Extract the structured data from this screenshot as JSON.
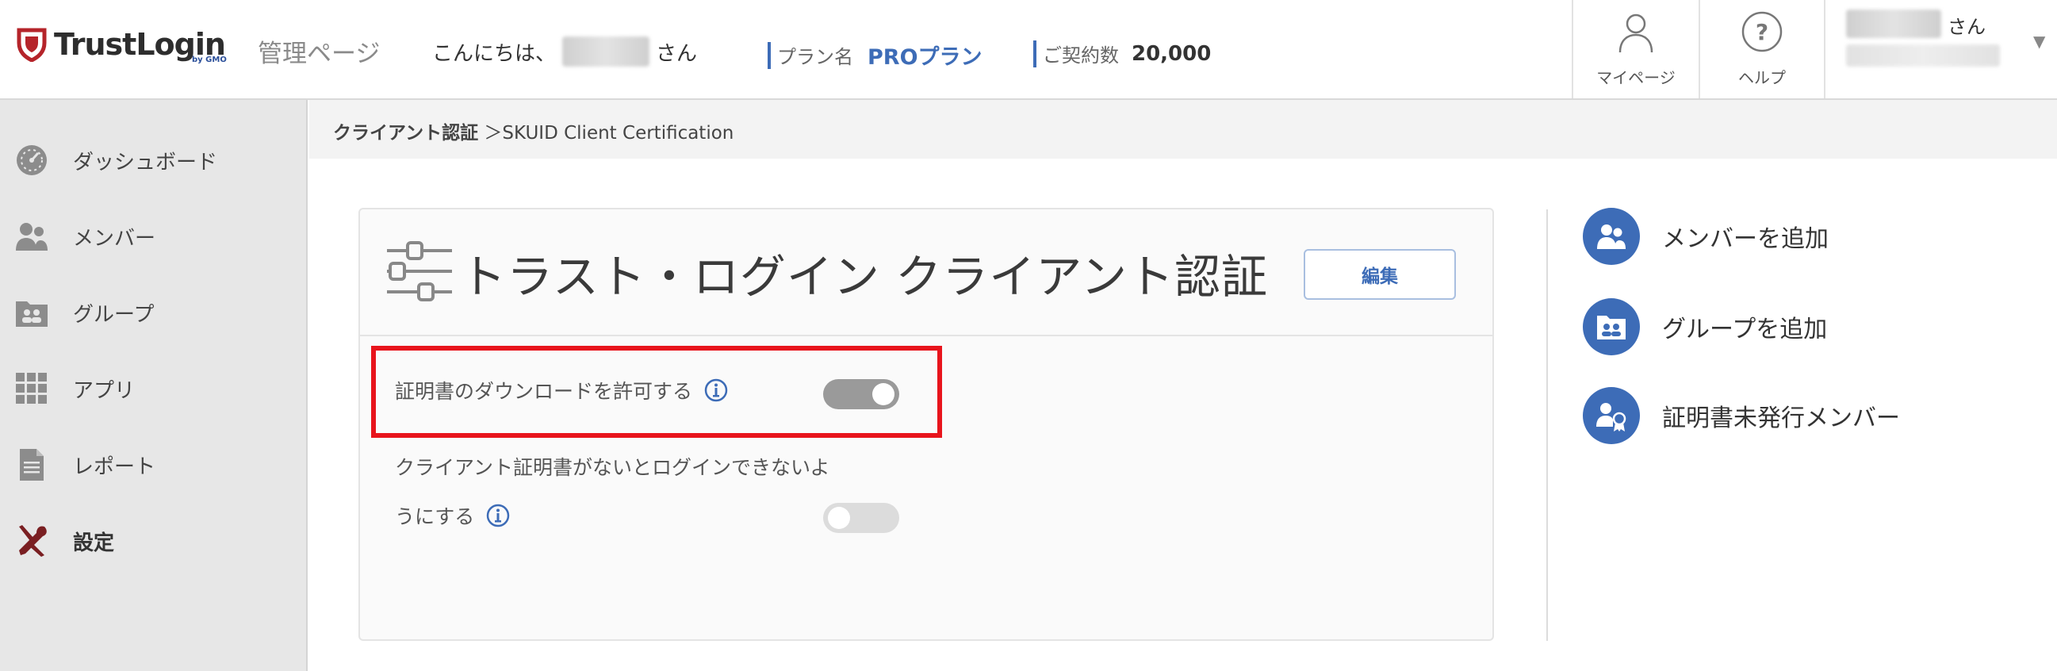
{
  "header": {
    "brand": "TrustLogin",
    "brand_by": "by GMO",
    "admin_title": "管理ページ",
    "greeting_prefix": "こんにちは、",
    "greeting_suffix": "さん",
    "plan_label": "プラン名",
    "plan_value": "PROプラン",
    "contract_label": "ご契約数",
    "contract_value": "20,000",
    "mypage_label": "マイページ",
    "help_label": "ヘルプ",
    "user_suffix": "さん"
  },
  "sidebar": {
    "items": [
      {
        "label": "ダッシュボード",
        "icon": "dashboard-icon"
      },
      {
        "label": "メンバー",
        "icon": "members-icon"
      },
      {
        "label": "グループ",
        "icon": "group-icon"
      },
      {
        "label": "アプリ",
        "icon": "apps-icon"
      },
      {
        "label": "レポート",
        "icon": "report-icon"
      },
      {
        "label": "設定",
        "icon": "settings-tools-icon",
        "active": true
      }
    ]
  },
  "breadcrumb": {
    "parent": "クライアント認証",
    "separator": "＞",
    "current": "SKUID Client Certification"
  },
  "card": {
    "title": "トラスト・ログイン クライアント認証",
    "edit_label": "編集",
    "settings": [
      {
        "label": "証明書のダウンロードを許可する",
        "enabled": true
      },
      {
        "label_line1": "クライアント証明書がないとログインできないよ",
        "label_line2": "うにする",
        "enabled": false
      }
    ]
  },
  "actions": [
    {
      "label": "メンバーを追加",
      "icon": "add-member-icon"
    },
    {
      "label": "グループを追加",
      "icon": "add-group-icon"
    },
    {
      "label": "証明書未発行メンバー",
      "icon": "uncertified-member-icon"
    }
  ],
  "colors": {
    "accent": "#3d6cb7",
    "brand_red": "#b5242a",
    "highlight": "#e8141c",
    "sidebar_bg": "#e7e7e7"
  }
}
